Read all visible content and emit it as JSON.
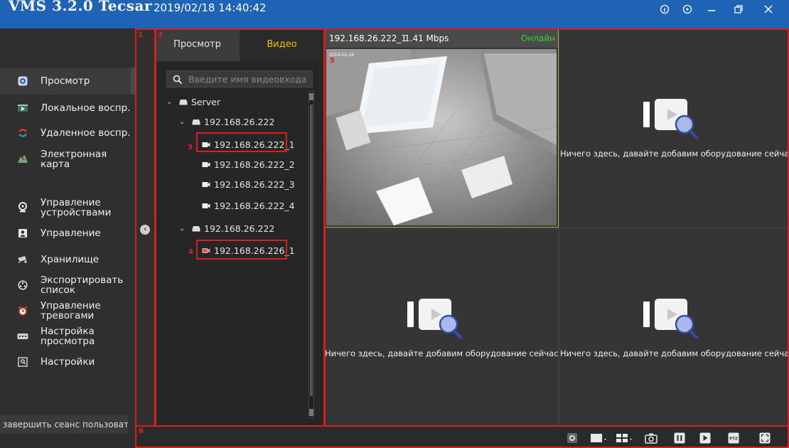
{
  "titlebar": {
    "app_name": "VMS 3.2.0 Tecsar",
    "datetime": "2019/02/18 14:40:42"
  },
  "sidebar": {
    "items": [
      {
        "label": "Просмотр",
        "icon": "live-view-icon"
      },
      {
        "label": "Локальное воспр.",
        "icon": "local-playback-icon"
      },
      {
        "label": "Удаленное воспр.",
        "icon": "remote-playback-icon"
      },
      {
        "label": "Электронная карта",
        "icon": "emap-icon"
      },
      {
        "label": "Управление устройствами",
        "icon": "device-management-icon"
      },
      {
        "label": "Управление",
        "icon": "user-management-icon"
      },
      {
        "label": "Хранилище",
        "icon": "storage-icon"
      },
      {
        "label": "Экспортировать список",
        "icon": "export-icon"
      },
      {
        "label": "Управление тревогами",
        "icon": "alarm-icon"
      },
      {
        "label": "Настройка просмотра",
        "icon": "view-settings-icon"
      },
      {
        "label": "Настройки",
        "icon": "settings-icon"
      }
    ],
    "logout": "завершить сеанс пользовател"
  },
  "device_panel": {
    "tabs": [
      "Просмотр",
      "Видео"
    ],
    "search_placeholder": "Введите имя видеовхода",
    "tree": {
      "root": "Server",
      "group1": "192.168.26.222",
      "channels1": [
        "192.168.26.222_1",
        "192.168.26.222_2",
        "192.168.26.222_3",
        "192.168.26.222_4"
      ],
      "group2": "192.168.26.222",
      "channels2": [
        "192.168.26.226_1"
      ]
    }
  },
  "video": {
    "active": {
      "name": "192.168.26.222_1",
      "bitrate": "1.41 Mbps",
      "status": "Онлайн",
      "timestamp": "2019-02-18"
    },
    "empty_text": "Ничего здесь, давайте добавим оборудование сейчас!"
  },
  "toolbar": {
    "buttons": [
      "snapshot-rec-icon",
      "layout-single-icon",
      "layout-grid-icon",
      "camera-icon",
      "pause-icon",
      "play-icon",
      "ptz-icon",
      "fullscreen-icon"
    ],
    "ptz_label": "PTZ"
  },
  "annotations": [
    "1",
    "2",
    "3",
    "4",
    "5",
    "6"
  ],
  "colors": {
    "title_bar": "#1e63b6",
    "active_tab": "#f2c200",
    "online": "#3cd22e",
    "annotation": "#d61f1f"
  }
}
